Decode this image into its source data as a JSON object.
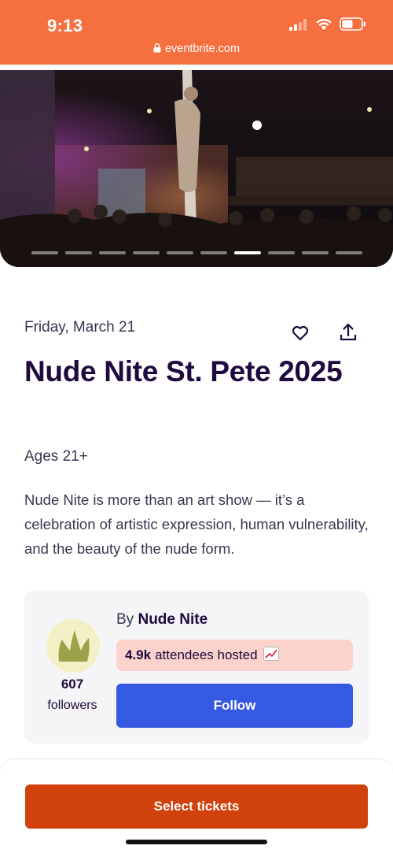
{
  "status_bar": {
    "time": "9:13",
    "url": "eventbrite.com",
    "icons": [
      "signal-icon",
      "wifi-icon",
      "battery-icon"
    ],
    "background": "#f56f3f"
  },
  "hero": {
    "carousel_total": 10,
    "carousel_active_index": 6
  },
  "event": {
    "date": "Friday, March 21",
    "title": "Nude Nite St. Pete 2025",
    "ages": "Ages 21+",
    "description": "Nude Nite is more than an art show — it’s a celebration of artistic expression, human vulnerability, and the beauty of the nude form."
  },
  "actions": {
    "like_icon": "heart-icon",
    "share_icon": "share-icon"
  },
  "organizer": {
    "by_prefix": "By",
    "name": "Nude Nite",
    "followers_count": "607",
    "followers_label": "followers",
    "hosted_count": "4.9k",
    "hosted_text": "attendees hosted",
    "hosted_emoji": "📈",
    "follow_label": "Follow"
  },
  "footer": {
    "select_tickets_label": "Select tickets"
  },
  "colors": {
    "accent_orange": "#d1410c",
    "follow_blue": "#3659e3",
    "hosted_pink": "#fbd2cc",
    "title_navy": "#1e0a3c"
  }
}
